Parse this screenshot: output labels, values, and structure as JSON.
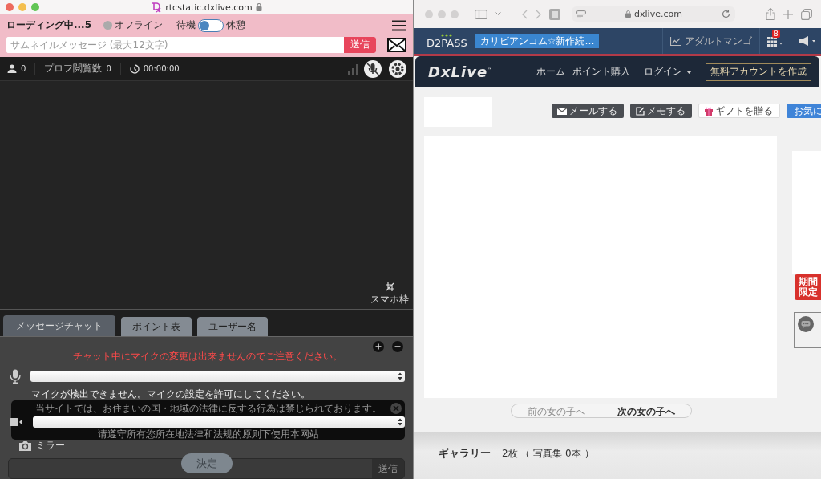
{
  "left_window": {
    "title": "rtcstatic.dxlive.com",
    "header": {
      "loading": "ローディング中...5",
      "status": {
        "label": "オフライン",
        "online": false
      },
      "toggle": {
        "left_label": "待機",
        "right_label": "休憩",
        "on": false
      },
      "message_field": {
        "placeholder": "サムネイルメッセージ (最大12文字)"
      },
      "send_button": "送信"
    },
    "stats": {
      "viewers": "0",
      "profile_views_label": "プロフ閲覧数",
      "profile_views": "0",
      "timer": "00:00:00"
    },
    "video": {
      "frame_label": "スマホ枠"
    },
    "tabs": [
      {
        "label": "メッセージチャット",
        "selected": true
      },
      {
        "label": "ポイント表",
        "selected": false
      },
      {
        "label": "ユーザー名",
        "selected": false
      }
    ],
    "panel": {
      "warning": "チャット中にマイクの変更は出来ませんのでご注意ください。",
      "mic_error": "マイクが検出できません。マイクの設定を許可にしてください。",
      "mirror_label": "ミラー",
      "chat_send_button": "送信",
      "confirm_button": "決定"
    },
    "notice": {
      "lines": [
        "当サイトでは、お住まいの国・地域の法律に反する行為は禁じられております。",
        "请遵守所有您所在地法律和法规的原则下使用本网站"
      ]
    }
  },
  "right_window": {
    "url": "dxlive.com",
    "topbar": {
      "logo": "D2PASS",
      "promo": "カリビアンコム☆新作続…",
      "link": "アダルトマンゴ",
      "badge": "8"
    },
    "nav": {
      "logo": "DxLive",
      "logo_mark": "™",
      "links": [
        "ホーム",
        "ポイント購入"
      ],
      "login": "ログイン",
      "signup": "無料アカウントを作成"
    },
    "actions": [
      {
        "label": "メールする",
        "kind": "mail"
      },
      {
        "label": "メモする",
        "kind": "memo"
      },
      {
        "label": "ギフトを贈る",
        "kind": "gift"
      },
      {
        "label": "お気に",
        "kind": "favorite"
      }
    ],
    "promo_badge": [
      "期間",
      "限定"
    ],
    "pager": [
      {
        "label": "前の女の子へ",
        "disabled": true
      },
      {
        "label": "次の女の子へ",
        "disabled": false
      }
    ],
    "gallery": {
      "title": "ギャラリー",
      "count": "2枚 （ 写真集 0本 ）"
    }
  }
}
